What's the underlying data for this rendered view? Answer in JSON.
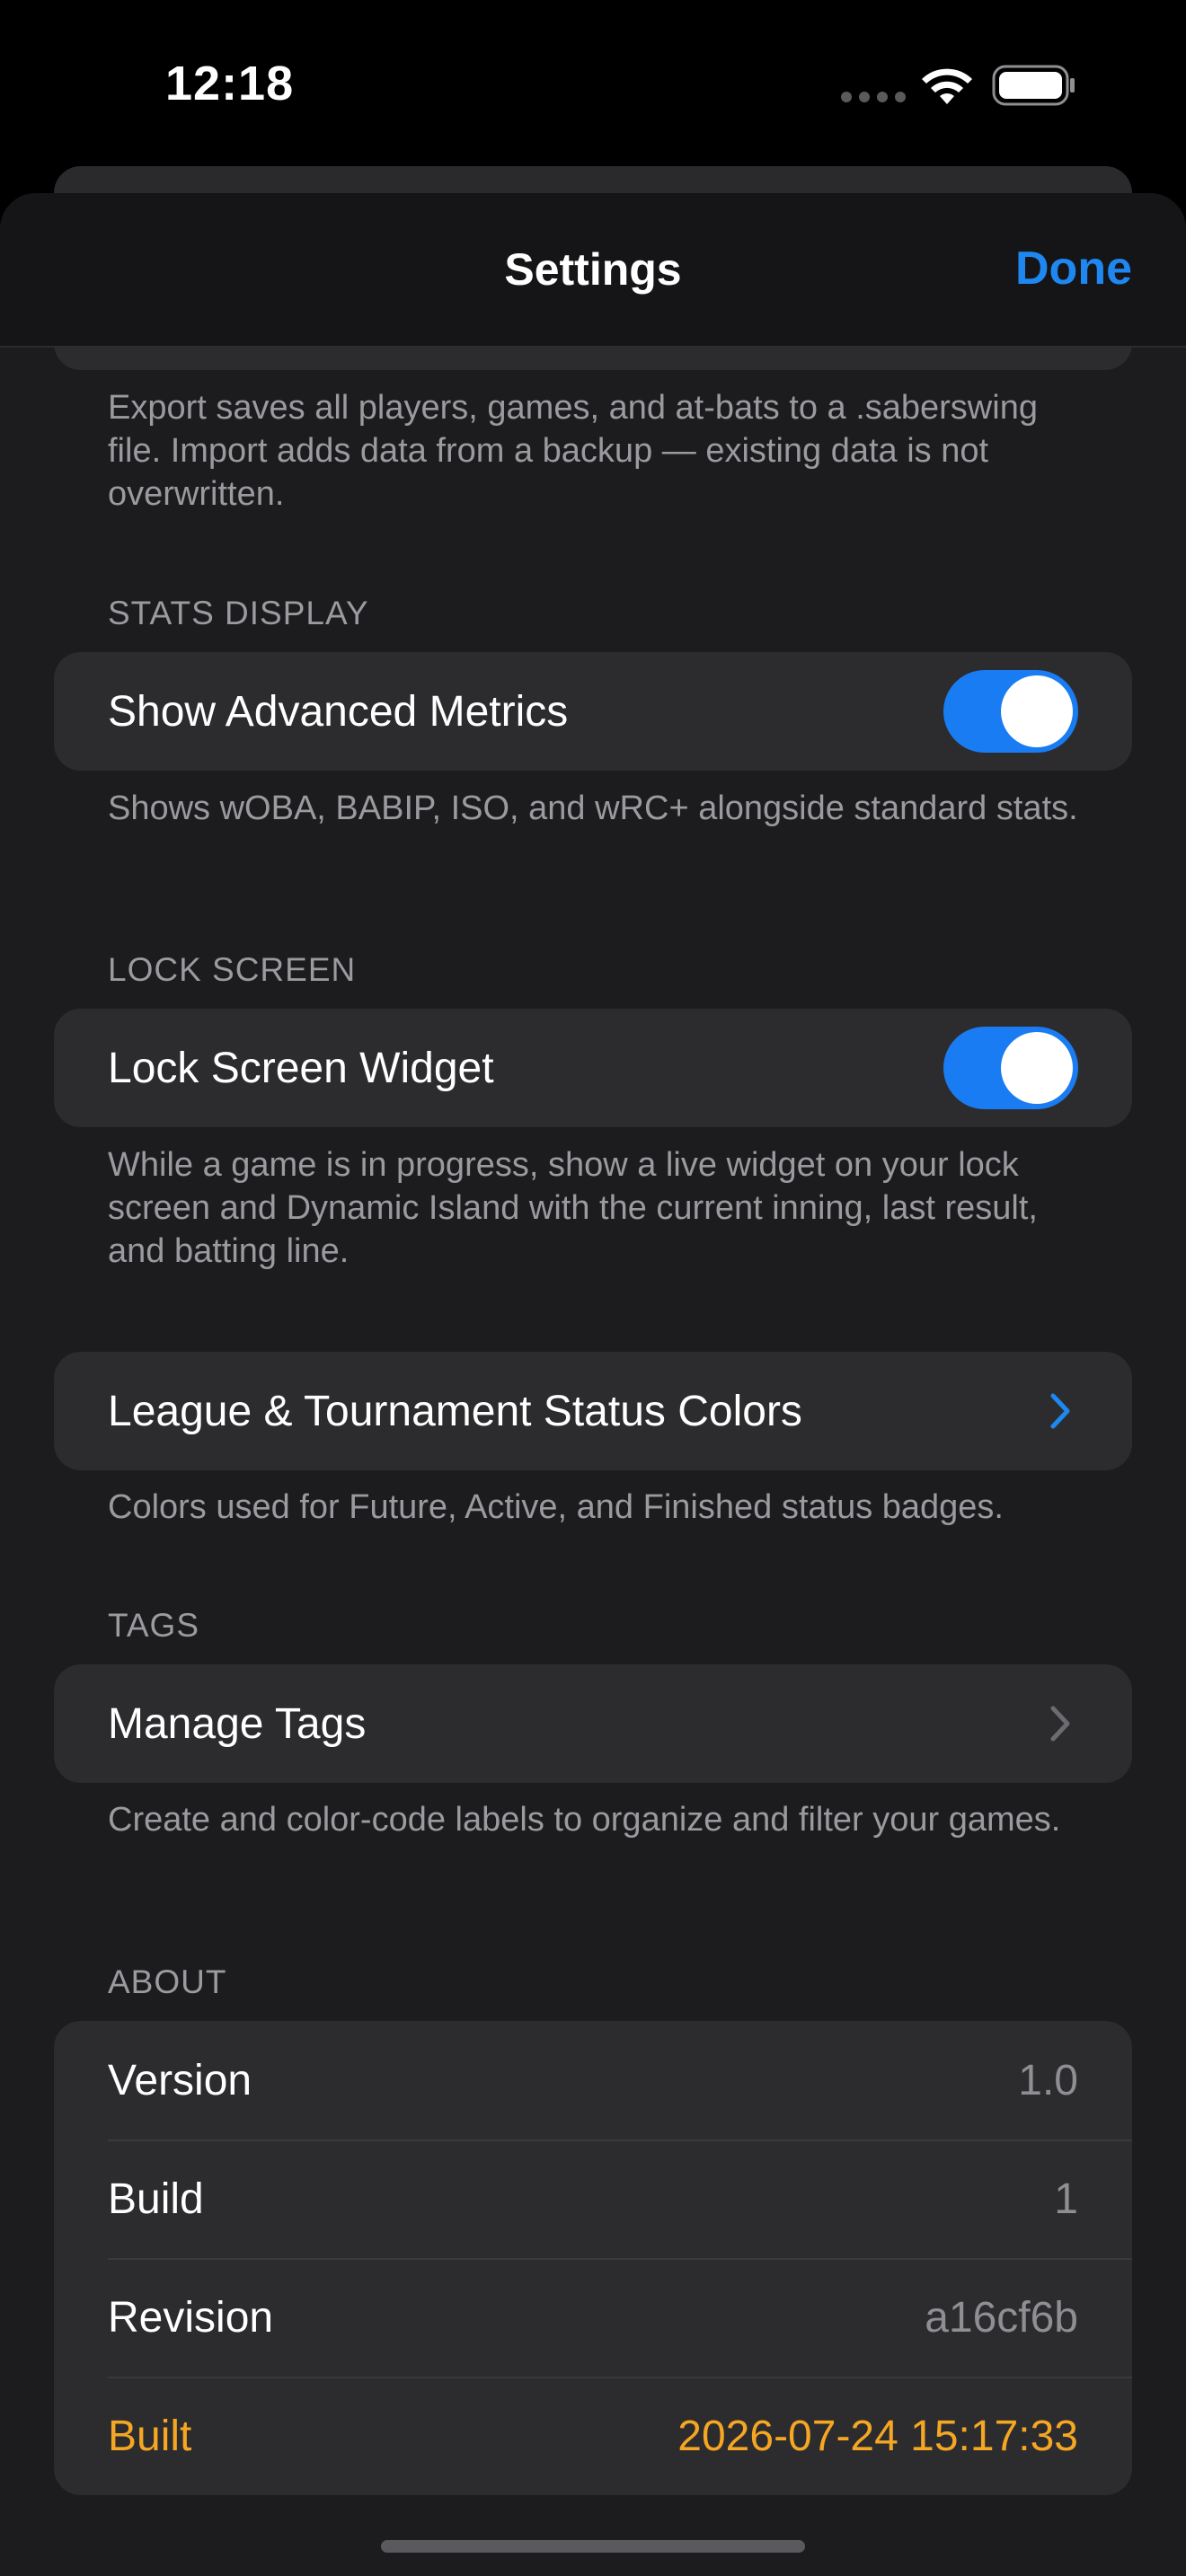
{
  "status_bar": {
    "time": "12:18"
  },
  "nav": {
    "title": "Settings",
    "done_label": "Done"
  },
  "backup": {
    "footer": "Export saves all players, games, and at-bats to a .saberswing file. Import adds data from a backup — existing data is not overwritten."
  },
  "stats_display": {
    "header": "STATS DISPLAY",
    "advanced_metrics_label": "Show Advanced Metrics",
    "advanced_metrics_on": true,
    "footer": "Shows wOBA, BABIP, ISO, and wRC+ alongside standard stats."
  },
  "lock_screen": {
    "header": "LOCK SCREEN",
    "widget_label": "Lock Screen Widget",
    "widget_on": true,
    "footer": "While a game is in progress, show a live widget on your lock screen and Dynamic Island with the current inning, last result, and batting line."
  },
  "status_colors": {
    "label": "League & Tournament Status Colors",
    "footer": "Colors used for Future, Active, and Finished status badges."
  },
  "tags": {
    "header": "TAGS",
    "label": "Manage Tags",
    "footer": "Create and color-code labels to organize and filter your games."
  },
  "about": {
    "header": "ABOUT",
    "rows": [
      {
        "label": "Version",
        "value": "1.0"
      },
      {
        "label": "Build",
        "value": "1"
      },
      {
        "label": "Revision",
        "value": "a16cf6b"
      },
      {
        "label": "Built",
        "value": "2026-07-24 15:17:33"
      }
    ]
  },
  "colors": {
    "accent_blue": "#1e88f0",
    "toggle_on": "#1a7cf2",
    "built_orange": "#f5a623",
    "background": "#1c1c1e",
    "card": "#2c2c2e"
  }
}
